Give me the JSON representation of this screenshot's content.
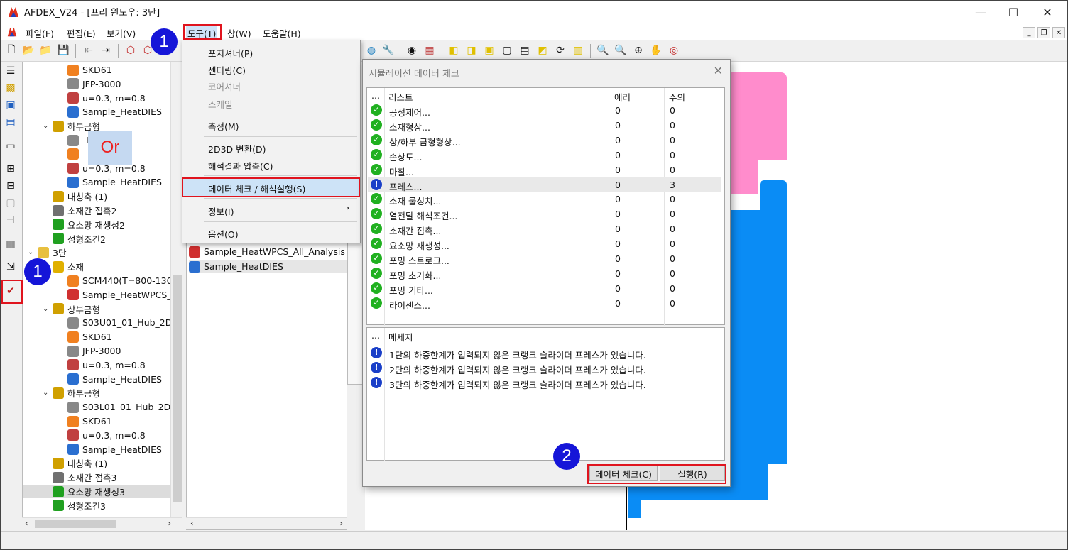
{
  "window": {
    "title": "AFDEX_V24 - [프리 윈도우: 3단]",
    "minimize": "—",
    "maximize": "☐",
    "close": "✕"
  },
  "menubar": {
    "file": "파일(F)",
    "edit": "편집(E)",
    "view": "보기(V)",
    "tools": "도구(T)",
    "window": "창(W)",
    "help": "도움말(H)"
  },
  "tools_menu": {
    "positioner": "포지셔너(P)",
    "centering": "센터링(C)",
    "corer": "코어셔너",
    "scale": "스케일",
    "measure": "측정(M)",
    "convert": "2D3D 변환(D)",
    "compress": "해석결과 압축(C)",
    "datacheck": "데이터 체크 / 해석실행(S)",
    "info": "정보(I)",
    "options": "옵션(O)"
  },
  "tree": {
    "rows": [
      {
        "text": "SKD61",
        "indent": 3,
        "color": "#f08020"
      },
      {
        "text": "JFP-3000",
        "indent": 3,
        "color": "#888888"
      },
      {
        "text": "u=0.3, m=0.8",
        "indent": 3,
        "color": "#c04040"
      },
      {
        "text": "Sample_HeatDIES",
        "indent": 3,
        "color": "#2a6fd0"
      },
      {
        "text": "하부금형",
        "indent": 2,
        "color": "#d0a000",
        "caret": "⌄"
      },
      {
        "text": "_Hub_2D",
        "indent": 3,
        "color": "#888888"
      },
      {
        "text": "",
        "indent": 3,
        "color": "#f08020"
      },
      {
        "text": "u=0.3, m=0.8",
        "indent": 3,
        "color": "#c04040"
      },
      {
        "text": "Sample_HeatDIES",
        "indent": 3,
        "color": "#2a6fd0"
      },
      {
        "text": "대칭축 (1)",
        "indent": 2,
        "color": "#d0a000"
      },
      {
        "text": "소재간 접촉2",
        "indent": 2,
        "color": "#707070"
      },
      {
        "text": "요소망 재생성2",
        "indent": 2,
        "color": "#20a020"
      },
      {
        "text": "성형조건2",
        "indent": 2,
        "color": "#20a020"
      },
      {
        "text": "3단",
        "indent": 1,
        "color": "#e8c040",
        "caret": "⌄"
      },
      {
        "text": "소재",
        "indent": 2,
        "color": "#e0b000",
        "caret": "⌄"
      },
      {
        "text": "SCM440(T=800-130",
        "indent": 3,
        "color": "#f08020"
      },
      {
        "text": "Sample_HeatWPCS_",
        "indent": 3,
        "color": "#d03030"
      },
      {
        "text": "상부금형",
        "indent": 2,
        "color": "#d0a000",
        "caret": "⌄"
      },
      {
        "text": "S03U01_01_Hub_2D",
        "indent": 3,
        "color": "#888888"
      },
      {
        "text": "SKD61",
        "indent": 3,
        "color": "#f08020"
      },
      {
        "text": "JFP-3000",
        "indent": 3,
        "color": "#888888"
      },
      {
        "text": "u=0.3, m=0.8",
        "indent": 3,
        "color": "#c04040"
      },
      {
        "text": "Sample_HeatDIES",
        "indent": 3,
        "color": "#2a6fd0"
      },
      {
        "text": "하부금형",
        "indent": 2,
        "color": "#d0a000",
        "caret": "⌄"
      },
      {
        "text": "S03L01_01_Hub_2D",
        "indent": 3,
        "color": "#888888"
      },
      {
        "text": "SKD61",
        "indent": 3,
        "color": "#f08020"
      },
      {
        "text": "u=0.3, m=0.8",
        "indent": 3,
        "color": "#c04040"
      },
      {
        "text": "Sample_HeatDIES",
        "indent": 3,
        "color": "#2a6fd0"
      },
      {
        "text": "대칭축 (1)",
        "indent": 2,
        "color": "#d0a000"
      },
      {
        "text": "소재간 접촉3",
        "indent": 2,
        "color": "#707070"
      },
      {
        "text": "요소망 재생성3",
        "indent": 2,
        "color": "#20a020",
        "selected": true
      },
      {
        "text": "성형조건3",
        "indent": 2,
        "color": "#20a020"
      }
    ]
  },
  "mid_panel": {
    "item1": "Sample_HeatWPCS_All_Analysis",
    "item2": "Sample_HeatDIES"
  },
  "dialog": {
    "title": "시뮬레이션 데이터 체크",
    "list_headers": {
      "dots": "...",
      "list": "리스트",
      "error": "에러",
      "warn": "주의"
    },
    "rows": [
      {
        "name": "공정제어...",
        "err": "0",
        "warn": "0",
        "status": "ok"
      },
      {
        "name": "소재형상...",
        "err": "0",
        "warn": "0",
        "status": "ok"
      },
      {
        "name": "상/하부 금형형상...",
        "err": "0",
        "warn": "0",
        "status": "ok"
      },
      {
        "name": "손상도...",
        "err": "0",
        "warn": "0",
        "status": "ok"
      },
      {
        "name": "마찰...",
        "err": "0",
        "warn": "0",
        "status": "ok"
      },
      {
        "name": "프레스...",
        "err": "0",
        "warn": "3",
        "status": "warn"
      },
      {
        "name": "소재 물성치...",
        "err": "0",
        "warn": "0",
        "status": "ok"
      },
      {
        "name": "열전달 해석조건...",
        "err": "0",
        "warn": "0",
        "status": "ok"
      },
      {
        "name": "소재간 접촉...",
        "err": "0",
        "warn": "0",
        "status": "ok"
      },
      {
        "name": "요소망 재생성...",
        "err": "0",
        "warn": "0",
        "status": "ok"
      },
      {
        "name": "포밍 스트로크...",
        "err": "0",
        "warn": "0",
        "status": "ok"
      },
      {
        "name": "포밍 초기화...",
        "err": "0",
        "warn": "0",
        "status": "ok"
      },
      {
        "name": "포밍 기타...",
        "err": "0",
        "warn": "0",
        "status": "ok"
      },
      {
        "name": "라이센스...",
        "err": "0",
        "warn": "0",
        "status": "ok"
      }
    ],
    "msg_headers": {
      "dots": "...",
      "message": "메세지"
    },
    "messages": [
      "1단의 하중한계가 입력되지 않은 크랭크 슬라이더 프레스가 있습니다.",
      "2단의 하중한계가 입력되지 않은 크랭크 슬라이더 프레스가 있습니다.",
      "3단의 하중한계가 입력되지 않은 크랭크 슬라이더 프레스가 있습니다."
    ],
    "btn_check": "데이터 체크(C)",
    "btn_run": "실행(R)"
  },
  "annotations": {
    "badge1": "1",
    "badge2": "2",
    "or": "Or"
  },
  "colors": {
    "annotation_red": "#e0141e",
    "badge_blue": "#1515d8",
    "die_pink": "#ff8ccc",
    "die_blue": "#0a8cf5"
  }
}
